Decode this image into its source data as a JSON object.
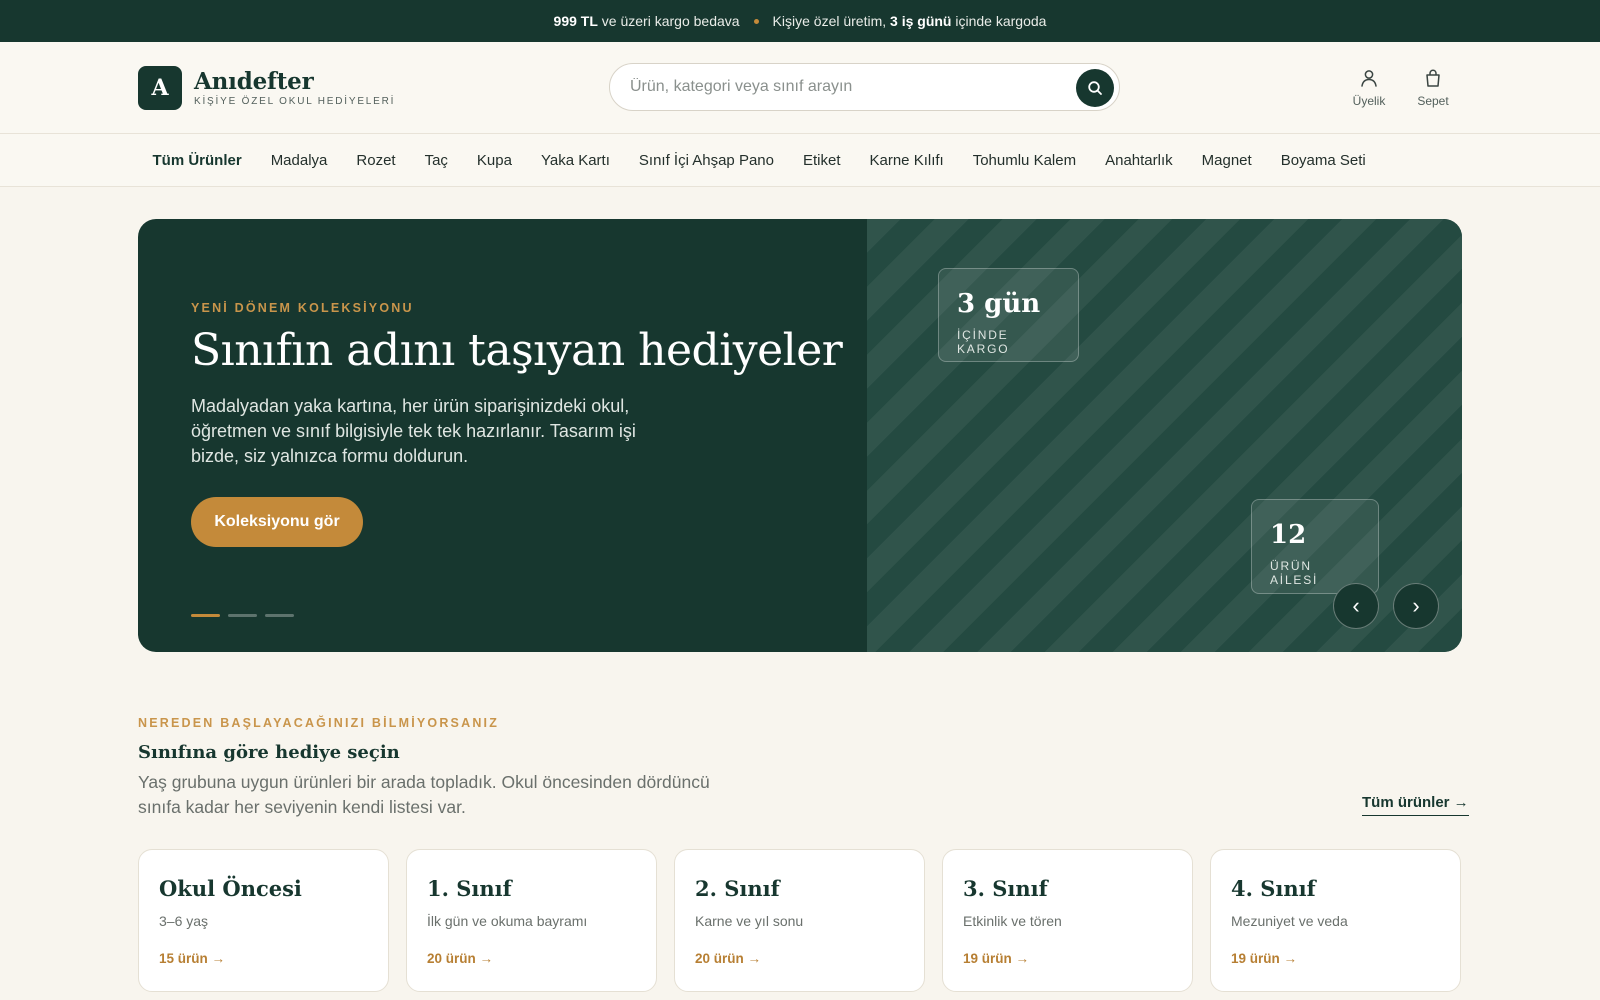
{
  "announcement": {
    "threshold": "999 TL",
    "threshold_suffix": " ve üzeri kargo bedava",
    "production_prefix": "Kişiye özel üretim, ",
    "days": "3 iş günü",
    "days_suffix": " içinde kargoda"
  },
  "brand": {
    "mark": "A",
    "name": "Anıdefter",
    "tagline": "KİŞİYE ÖZEL OKUL HEDİYELERİ"
  },
  "search": {
    "placeholder": "Ürün, kategori veya sınıf arayın",
    "value": ""
  },
  "header_actions": {
    "account": "Üyelik",
    "cart": "Sepet"
  },
  "categories": [
    "Tüm Ürünler",
    "Madalya",
    "Rozet",
    "Taç",
    "Kupa",
    "Yaka Kartı",
    "Sınıf İçi Ahşap Pano",
    "Etiket",
    "Karne Kılıfı",
    "Tohumlu Kalem",
    "Anahtarlık",
    "Magnet",
    "Boyama Seti"
  ],
  "active_category": "Tüm Ürünler",
  "hero": {
    "eyebrow": "YENİ DÖNEM KOLEKSİYONU",
    "title": "Sınıfın adını taşıyan hediyeler",
    "text": "Madalyadan yaka kartına, her ürün siparişinizdeki okul, öğretmen ve sınıf bilgisiyle tek tek hazırlanır. Tasarım işi bizde, siz yalnızca formu doldurun.",
    "cta": "Koleksiyonu gör",
    "slides": 3,
    "active_slide": 1,
    "stat1": {
      "value": "3 gün",
      "label": "İÇİNDE KARGO"
    },
    "stat2": {
      "value": "12",
      "label": "ÜRÜN AİLESİ"
    },
    "prev": "‹",
    "next": "›"
  },
  "section": {
    "eyebrow": "NEREDEN BAŞLAYACAĞINIZI BİLMİYORSANIZ",
    "title": "Sınıfına göre hediye seçin",
    "description": "Yaş grubuna uygun ürünleri bir arada topladık. Okul öncesinden dördüncü sınıfa kadar her seviyenin kendi listesi var.",
    "link": "Tüm ürünler →"
  },
  "grade_cards": [
    {
      "title": "Okul Öncesi",
      "subtitle": "3–6 yaş",
      "count": "15 ürün →"
    },
    {
      "title": "1. Sınıf",
      "subtitle": "İlk gün ve okuma bayramı",
      "count": "20 ürün →"
    },
    {
      "title": "2. Sınıf",
      "subtitle": "Karne ve yıl sonu",
      "count": "20 ürün →"
    },
    {
      "title": "3. Sınıf",
      "subtitle": "Etkinlik ve tören",
      "count": "19 ürün →"
    },
    {
      "title": "4. Sınıf",
      "subtitle": "Mezuniyet ve veda",
      "count": "19 ürün →"
    }
  ],
  "colors": {
    "primary": "#17372f",
    "accent": "#c48a3a",
    "background": "#f8f5ee"
  },
  "icons": {
    "search": "search-icon",
    "account": "user-icon",
    "cart": "shopping-bag-icon"
  }
}
